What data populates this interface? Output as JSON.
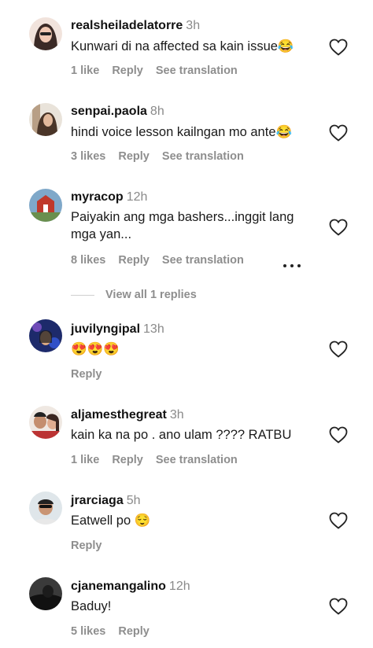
{
  "comments": [
    {
      "username": "realsheiladelatorre",
      "time": "3h",
      "text": "Kunwari di na affected sa kain issue😂",
      "likes": "1 like",
      "reply": "Reply",
      "translate": "See translation",
      "avatar_color": "#6d4c41"
    },
    {
      "username": "senpai.paola",
      "time": "8h",
      "text": "hindi voice lesson kailngan mo ante😂",
      "likes": "3 likes",
      "reply": "Reply",
      "translate": "See translation",
      "avatar_color": "#c9b8a4"
    },
    {
      "username": "myracop",
      "time": "12h",
      "text": "Paiyakin ang mga bashers...inggit lang mga yan...",
      "likes": "8 likes",
      "reply": "Reply",
      "translate": "See translation",
      "avatar_color": "#b23a3a"
    },
    {
      "username": "juvilyngipal",
      "time": "13h",
      "text": "😍😍😍",
      "likes": "",
      "reply": "Reply",
      "translate": "",
      "avatar_color": "#2b3a8f"
    },
    {
      "username": "aljamesthegreat",
      "time": "3h",
      "text": "kain ka na po . ano ulam ???? RATBU",
      "likes": "1 like",
      "reply": "Reply",
      "translate": "See translation",
      "avatar_color": "#8a6b5c"
    },
    {
      "username": "jrarciaga",
      "time": "5h",
      "text": "Eatwell po 😌",
      "likes": "",
      "reply": "Reply",
      "translate": "",
      "avatar_color": "#7a8c99"
    },
    {
      "username": "cjanemangalino",
      "time": "12h",
      "text": "Baduy!",
      "likes": "5 likes",
      "reply": "Reply",
      "translate": "",
      "avatar_color": "#2a2a2a"
    }
  ],
  "view_replies": "View all 1 replies",
  "icons": {
    "like": "heart-outline-icon",
    "more": "more-dots-icon"
  }
}
